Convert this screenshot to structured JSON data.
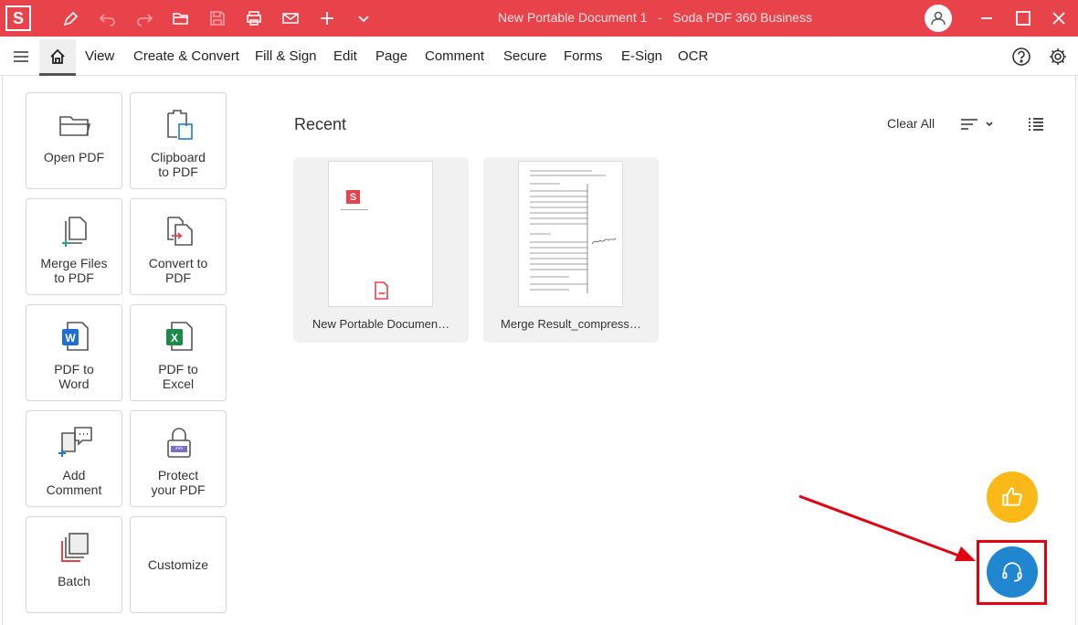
{
  "titlebar": {
    "logo": "S",
    "title": "New Portable Document 1   -   Soda PDF 360 Business"
  },
  "menu": {
    "items": [
      "View",
      "Create & Convert",
      "Fill & Sign",
      "Edit",
      "Page",
      "Comment",
      "Secure",
      "Forms",
      "E-Sign",
      "OCR"
    ]
  },
  "tiles": [
    {
      "label": "Open PDF",
      "icon": "folder-icon"
    },
    {
      "label": "Clipboard\nto PDF",
      "icon": "clipboard-icon"
    },
    {
      "label": "Merge Files\nto PDF",
      "icon": "merge-icon"
    },
    {
      "label": "Convert to\nPDF",
      "icon": "convert-icon"
    },
    {
      "label": "PDF to\nWord",
      "icon": "word-icon"
    },
    {
      "label": "PDF to\nExcel",
      "icon": "excel-icon"
    },
    {
      "label": "Add\nComment",
      "icon": "comment-icon"
    },
    {
      "label": "Protect\nyour PDF",
      "icon": "lock-icon"
    },
    {
      "label": "Batch",
      "icon": "batch-icon"
    },
    {
      "label": "Customize",
      "icon": ""
    }
  ],
  "recent": {
    "title": "Recent",
    "clear_label": "Clear All",
    "files": [
      {
        "name": "New Portable Documen…"
      },
      {
        "name": "Merge Result_compress…"
      }
    ]
  },
  "colors": {
    "brand": "#e8434a",
    "fab_like": "#fbb918",
    "fab_support": "#1f86cf",
    "highlight": "#e3000f"
  }
}
